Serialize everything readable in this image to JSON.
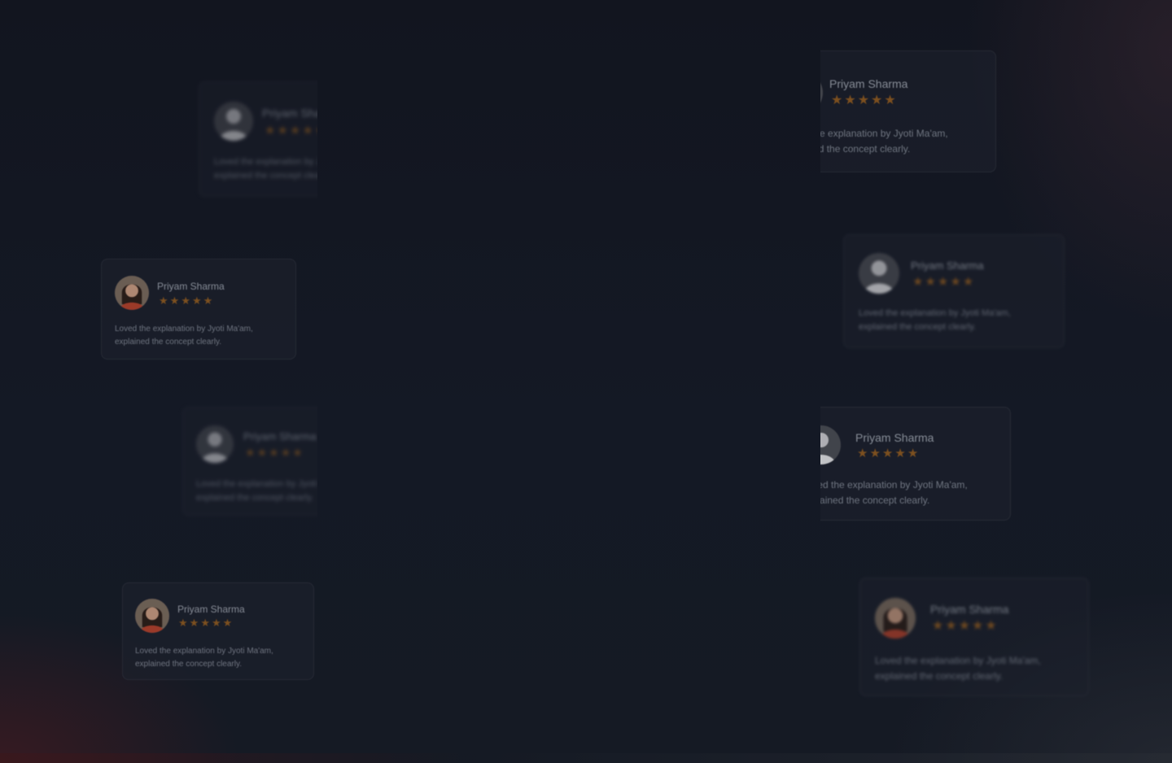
{
  "testimonials": [
    {
      "name": "Priyam Sharma",
      "rating": 5,
      "review_line1": "Loved the explanation by Jyoti Ma'am,",
      "review_line2": "explained the concept clearly.",
      "avatar": "man-portrait-icon"
    },
    {
      "name": "Priyam Sharma",
      "rating": 5,
      "review_line1": "Loved the explanation by Jyoti Ma'am,",
      "review_line2": "explained the concept clearly.",
      "avatar": "woman-portrait-icon"
    },
    {
      "name": "Priyam Sharma",
      "rating": 5,
      "review_line1": "Loved the explanation by Jyoti Ma'am,",
      "review_line2": "explained the concept clearly.",
      "avatar": "man-portrait-icon"
    },
    {
      "name": "Priyam Sharma",
      "rating": 5,
      "review_line1": "Loved the explanation by Jyoti Ma'am,",
      "review_line2": "explained the concept clearly.",
      "avatar": "woman-portrait-icon"
    },
    {
      "name": "Priyam Sharma",
      "rating": 5,
      "review_line1": "Loved the explanation by Jyoti Ma'am,",
      "review_line2": "explained the concept clearly.",
      "avatar": "man-portrait-icon"
    },
    {
      "name": "Priyam Sharma",
      "rating": 5,
      "review_line1": "Loved the explanation by Jyoti Ma'am,",
      "review_line2": "explained the concept clearly.",
      "avatar": "man-portrait-icon"
    },
    {
      "name": "Priyam Sharma",
      "rating": 5,
      "review_line1": "Loved the explanation by Jyoti Ma'am,",
      "review_line2": "explained the concept clearly.",
      "avatar": "man-portrait-icon"
    },
    {
      "name": "Priyam Sharma",
      "rating": 5,
      "review_line1": "Loved the explanation by Jyoti Ma'am,",
      "review_line2": "explained the concept clearly.",
      "avatar": "woman-portrait-icon"
    }
  ],
  "colors": {
    "background": "#131722",
    "card": "#1c202b",
    "star": "#8f5a1f",
    "name_text": "#9aa0aa",
    "review_text": "#7f8591"
  }
}
